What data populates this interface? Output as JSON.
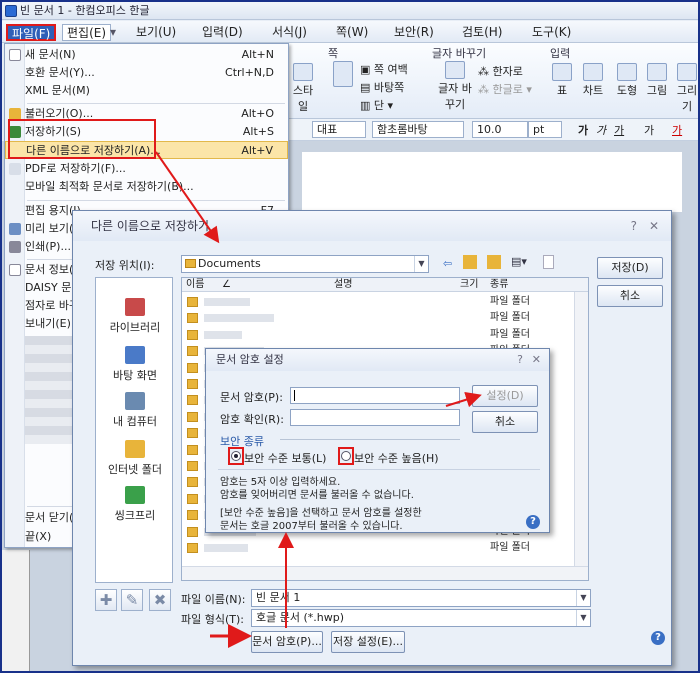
{
  "app": {
    "title": "빈 문서 1 - 한컴오피스 한글"
  },
  "menubar": {
    "items": [
      "파일(F)",
      "편집(E)",
      "보기(U)",
      "입력(D)",
      "서식(J)",
      "쪽(W)",
      "보안(R)",
      "검토(H)",
      "도구(K)"
    ]
  },
  "ribbon": {
    "groups": {
      "page": "쪽",
      "char_change": "글자 바꾸기",
      "input": "입력"
    },
    "buttons": {
      "style": "스타일",
      "page_margin": "쪽 여백",
      "background": "바탕쪽",
      "column": "단",
      "hanja": "한자로",
      "hangul": "한글로",
      "char_change": "글자 바꾸기",
      "table": "표",
      "chart": "차트",
      "shape": "도형",
      "picture": "그림",
      "draw": "그리기"
    }
  },
  "format_bar": {
    "style": "대표",
    "font": "함초롬바탕",
    "size": "10.0",
    "unit": "pt",
    "bold": "가",
    "italic": "가",
    "underline": "가",
    "strike": "가",
    "color": "가"
  },
  "file_menu": {
    "items": [
      {
        "label": "새 문서(N)",
        "shortcut": "Alt+N"
      },
      {
        "label": "호환 문서(Y)...",
        "shortcut": "Ctrl+N,D"
      },
      {
        "label": "XML 문서(M)",
        "shortcut": ""
      },
      {
        "label": "불러오기(O)...",
        "shortcut": "Alt+O"
      },
      {
        "label": "저장하기(S)",
        "shortcut": "Alt+S"
      },
      {
        "label": "다른 이름으로 저장하기(A)...",
        "shortcut": "Alt+V"
      },
      {
        "label": "PDF로 저장하기(F)...",
        "shortcut": ""
      },
      {
        "label": "모바일 최적화 문서로 저장하기(B)...",
        "shortcut": ""
      },
      {
        "label": "편집 용지(J)...",
        "shortcut": "F7"
      },
      {
        "label": "미리 보기(V)",
        "shortcut": ""
      },
      {
        "label": "인쇄(P)...",
        "shortcut": ""
      },
      {
        "label": "문서 정보(I)",
        "shortcut": ""
      },
      {
        "label": "DAISY 문서",
        "shortcut": ""
      },
      {
        "label": "점자로 바꾸기",
        "shortcut": ""
      },
      {
        "label": "보내기(E)",
        "shortcut": ""
      },
      {
        "label": "문서 닫기(C)",
        "shortcut": ""
      },
      {
        "label": "끝(X)",
        "shortcut": ""
      }
    ]
  },
  "save_dialog": {
    "title": "다른 이름으로 저장하기",
    "help": "?",
    "close": "✕",
    "location_label": "저장 위치(I):",
    "location_value": "Documents",
    "save_button": "저장(D)",
    "cancel_button": "취소",
    "places": [
      "라이브러리",
      "바탕 화면",
      "내 컴퓨터",
      "인터넷 폴더",
      "씽크프리"
    ],
    "columns": {
      "name": "이름",
      "desc": "설명",
      "size": "크기",
      "type": "종류"
    },
    "rows": [
      {
        "name": "",
        "type": "파일 폴더"
      },
      {
        "name": "",
        "type": "파일 폴더"
      },
      {
        "name": "",
        "type": "파일 폴더"
      },
      {
        "name": "",
        "type": "파일 폴더"
      },
      {
        "name": "",
        "type": "파일 폴더"
      },
      {
        "name": "",
        "type": "파일 폴더"
      },
      {
        "name": "",
        "type": "파일 폴더"
      },
      {
        "name": "",
        "type": "파일 폴더"
      },
      {
        "name": "",
        "type": "파일 폴더"
      },
      {
        "name": "",
        "type": "파일 폴더"
      },
      {
        "name": "",
        "type": "파일 폴더"
      },
      {
        "name": "",
        "type": "파일 폴더"
      },
      {
        "name": "",
        "type": "파일 폴더"
      },
      {
        "name": "",
        "type": "파일 폴더"
      },
      {
        "name": "",
        "type": "파일 폴더"
      },
      {
        "name": "",
        "type": "파일 폴더"
      }
    ],
    "filename_label": "파일 이름(N):",
    "filename_value": "빈 문서 1",
    "filetype_label": "파일 형식(T):",
    "filetype_value": "호글 문서 (*.hwp)",
    "password_button": "문서 암호(P)...",
    "save_settings_button": "저장 설정(E)..."
  },
  "password_dialog": {
    "title": "문서 암호 설정",
    "help": "?",
    "close": "✕",
    "password_label": "문서 암호(P):",
    "confirm_label": "암호 확인(R):",
    "set_button": "설정(D)",
    "cancel_button": "취소",
    "security_group": "보안 종류",
    "normal_option": "보안 수준 보통(L)",
    "high_option": "보안 수준 높음(H)",
    "note1": "암호는 5자 이상 입력하세요.",
    "note2": "암호를 잊어버리면 문서를 불러올 수 없습니다.",
    "note3": "[보안 수준 높음]을 선택하고 문서 암호를 설정한",
    "note4": "문서는 호글 2007부터 불러올 수 있습니다."
  },
  "colors": {
    "accent": "#2f5fb8",
    "highlight_box": "#e01a1a",
    "menu_highlight": "#fbe5a8",
    "arrow": "#e01a1a"
  }
}
